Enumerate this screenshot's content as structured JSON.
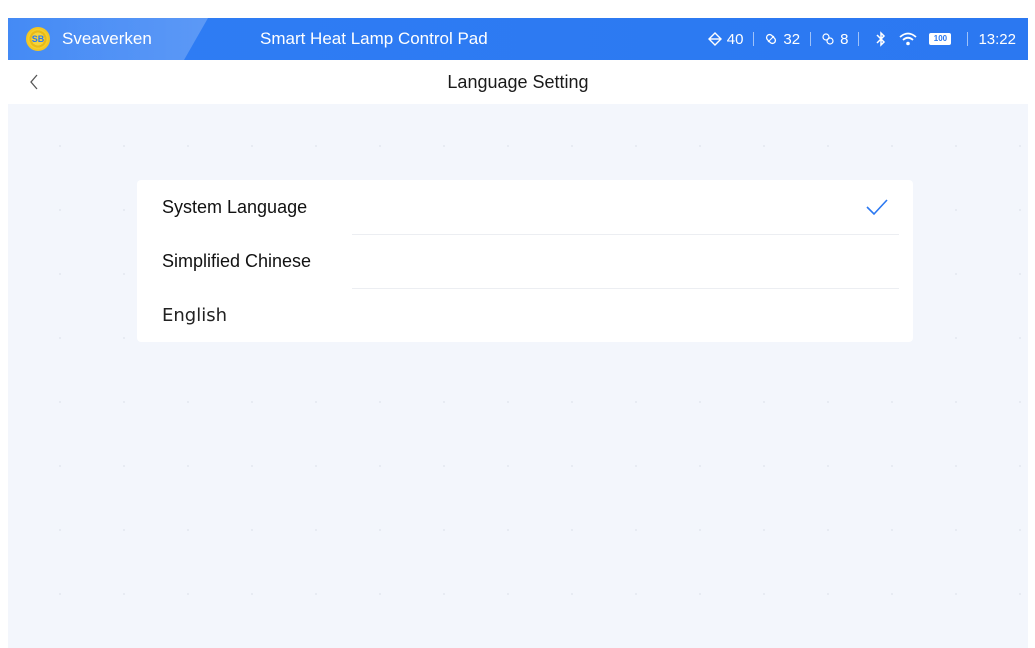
{
  "status_bar": {
    "brand_name": "Sveaverken",
    "logo_text": "SB",
    "app_title": "Smart Heat Lamp Control Pad",
    "stat1": "40",
    "stat2": "32",
    "stat3": "8",
    "battery": "100",
    "time": "13:22"
  },
  "nav": {
    "title": "Language Setting"
  },
  "languages": {
    "items": [
      {
        "label": "System Language",
        "selected": true
      },
      {
        "label": "Simplified Chinese",
        "selected": false
      },
      {
        "label": "English",
        "selected": false
      }
    ]
  },
  "colors": {
    "accent": "#2b78f1",
    "background": "#f3f6fc"
  },
  "icons": {
    "back": "chevron-left-icon",
    "check": "checkmark-icon",
    "bluetooth": "bluetooth-icon",
    "wifi": "wifi-icon"
  }
}
